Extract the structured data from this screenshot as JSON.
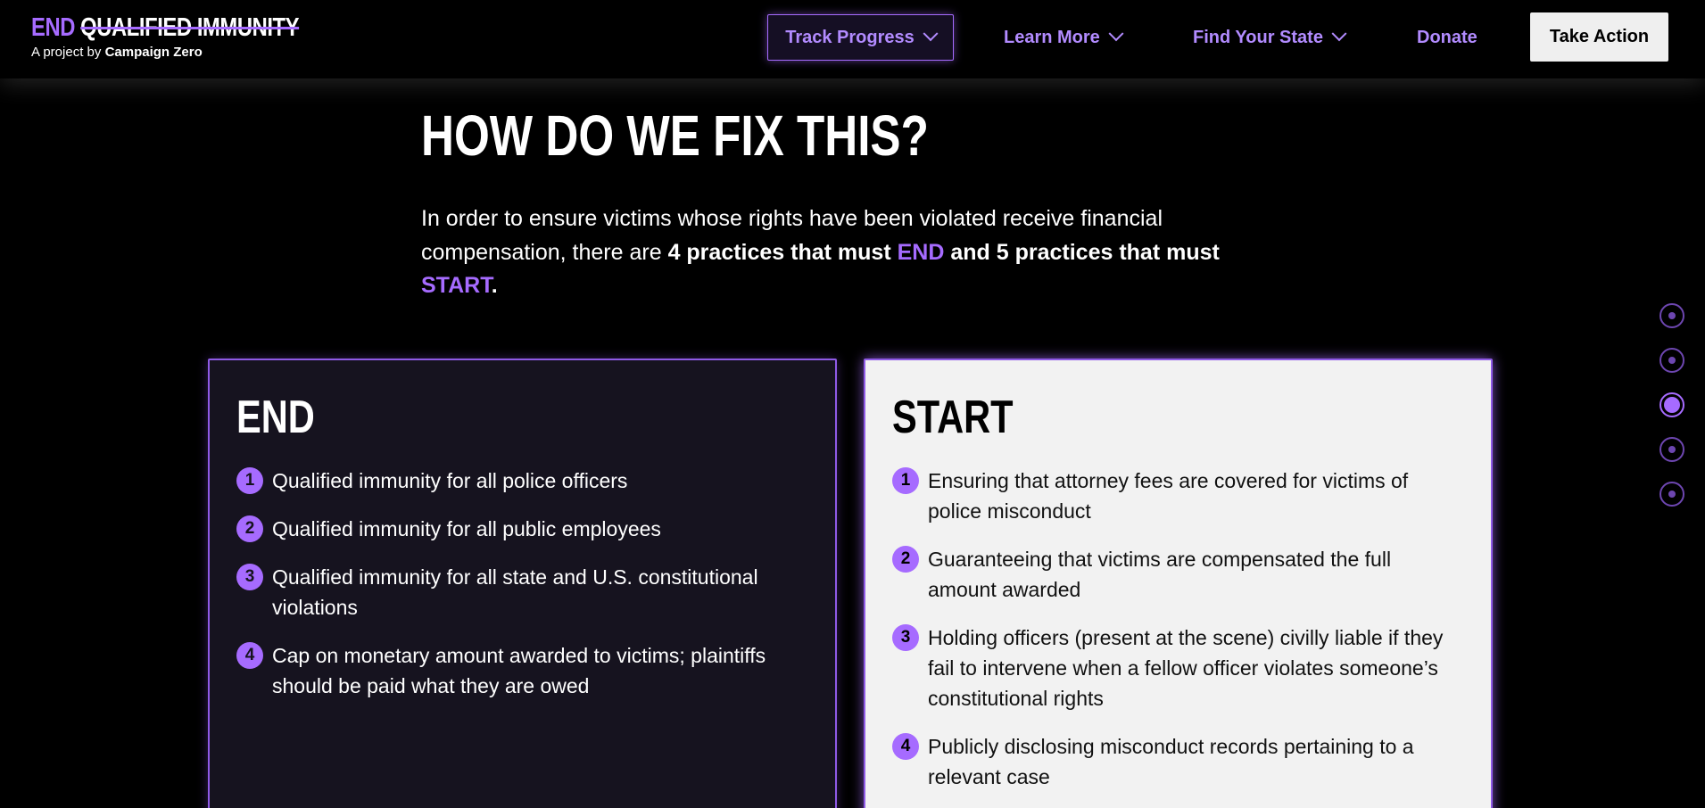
{
  "header": {
    "logo": {
      "end_word": "END",
      "rest_words": "QUALIFIED IMMUNITY",
      "sub_prefix": "A project by",
      "sub_org": "Campaign Zero"
    },
    "nav": {
      "track_progress": "Track Progress",
      "learn_more": "Learn More",
      "find_your_state": "Find Your State",
      "donate": "Donate",
      "take_action": "Take Action"
    }
  },
  "main": {
    "title": "HOW DO WE FIX THIS?",
    "intro": {
      "part1": "In order to ensure victims whose rights have been violated receive financial compensation, there are",
      "bold1": "4 practices that must",
      "end_word": "END",
      "bold2": "and 5 practices that must",
      "start_word": "START",
      "period": "."
    },
    "end_card": {
      "title": "END",
      "items": [
        {
          "num": "1",
          "text": "Qualified immunity for all police officers"
        },
        {
          "num": "2",
          "text": "Qualified immunity for all public employees"
        },
        {
          "num": "3",
          "text": "Qualified immunity for all state and U.S. constitutional violations"
        },
        {
          "num": "4",
          "text": "Cap on monetary amount awarded to victims; plaintiffs should be paid what they are owed"
        }
      ]
    },
    "start_card": {
      "title": "START",
      "items": [
        {
          "num": "1",
          "text": "Ensuring that attorney fees are covered for victims of police misconduct"
        },
        {
          "num": "2",
          "text": "Guaranteeing that victims are compensated the full amount awarded"
        },
        {
          "num": "3",
          "text": "Holding officers (present at the scene) civilly liable if they fail to intervene when a fellow officer violates someone’s constitutional rights"
        },
        {
          "num": "4",
          "text": "Publicly disclosing misconduct records pertaining to a relevant case"
        }
      ]
    }
  },
  "side_nav": {
    "active_index": 2,
    "count": 5
  },
  "colors": {
    "accent": "#a66bff",
    "background": "#000000",
    "end_card_bg": "#16131f",
    "start_card_bg": "#f2f2f2"
  }
}
